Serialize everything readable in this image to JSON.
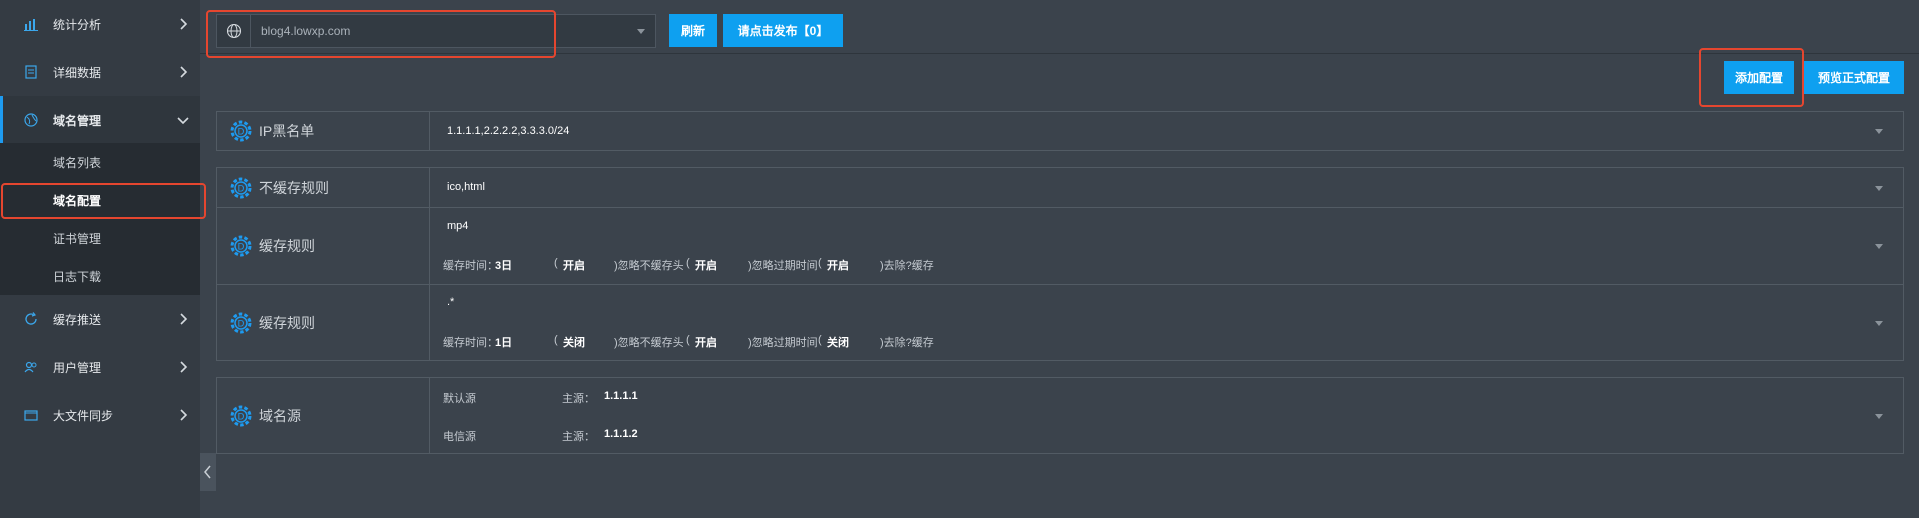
{
  "sidebar": {
    "items": [
      {
        "label": "统计分析",
        "icon": "bar-chart-icon"
      },
      {
        "label": "详细数据",
        "icon": "document-icon"
      },
      {
        "label": "域名管理",
        "icon": "globe-icon"
      },
      {
        "label": "缓存推送",
        "icon": "refresh-icon"
      },
      {
        "label": "用户管理",
        "icon": "users-icon"
      },
      {
        "label": "大文件同步",
        "icon": "folder-icon"
      }
    ],
    "subitems": [
      "域名列表",
      "域名配置",
      "证书管理",
      "日志下载"
    ]
  },
  "topbar": {
    "domain": "blog4.lowxp.com",
    "refresh_label": "刷新",
    "publish_label": "请点击发布【0】",
    "add_config_label": "添加配置",
    "preview_label": "预览正式配置"
  },
  "rows": {
    "ip_blacklist": {
      "label": "IP黑名单",
      "value": "1.1.1.1,2.2.2.2,3.3.3.0/24"
    },
    "no_cache": {
      "label": "不缓存规则",
      "value": "ico,html"
    },
    "cache1": {
      "label": "缓存规则",
      "value": "mp4",
      "time_label": "缓存时间：",
      "time_value": "3日",
      "paren_open": "(",
      "ignore_nocache_value": "开启",
      "ignore_nocache_label": ")忽略不缓存头",
      "ignore_expire_value": "开启",
      "ignore_expire_label": ")忽略过期时间",
      "strip_value": "开启",
      "strip_label": ")去除?缓存"
    },
    "cache2": {
      "label": "缓存规则",
      "value": ".*",
      "time_label": "缓存时间：",
      "time_value": "1日",
      "paren_open": "(",
      "ignore_nocache_value": "关闭",
      "ignore_nocache_label": ")忽略不缓存头",
      "ignore_expire_value": "开启",
      "ignore_expire_label": ")忽略过期时间",
      "strip_value": "关闭",
      "strip_label": ")去除?缓存"
    },
    "origin": {
      "label": "域名源",
      "lines": [
        {
          "name": "默认源",
          "key": "主源：",
          "value": "1.1.1.1"
        },
        {
          "name": "电信源",
          "key": "主源：",
          "value": "1.1.1.2"
        }
      ]
    }
  },
  "colors": {
    "accent": "#0ea0f0",
    "highlight": "#e5462f",
    "background": "#3b434c",
    "sidebar": "#343b43"
  }
}
